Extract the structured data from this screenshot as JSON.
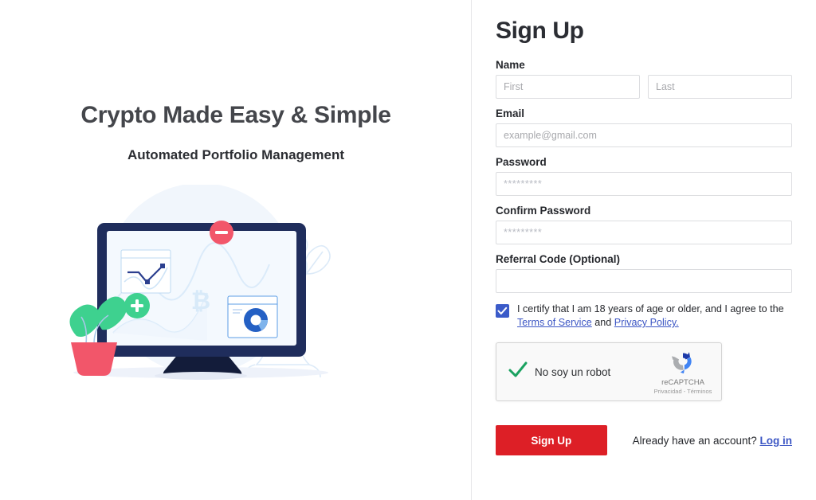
{
  "hero": {
    "title": "Crypto Made Easy & Simple",
    "subtitle": "Automated Portfolio Management",
    "illustration": {
      "bitcoin_glyph": "₿",
      "alt": "desktop monitor with trading charts, plant and vase"
    }
  },
  "form": {
    "heading": "Sign Up",
    "name": {
      "label": "Name",
      "first_placeholder": "First",
      "first_value": "",
      "last_placeholder": "Last",
      "last_value": ""
    },
    "email": {
      "label": "Email",
      "placeholder": "example@gmail.com",
      "value": ""
    },
    "password": {
      "label": "Password",
      "placeholder": "*********",
      "value": ""
    },
    "confirm_password": {
      "label": "Confirm Password",
      "placeholder": "*********",
      "value": ""
    },
    "referral": {
      "label": "Referral Code (Optional)",
      "placeholder": "",
      "value": ""
    },
    "certify": {
      "checked": true,
      "text_before": "I certify that I am 18 years of age or older, and I agree to the ",
      "terms_link": "Terms of Service",
      "text_between": " and ",
      "privacy_link": "Privacy Policy."
    },
    "recaptcha": {
      "label": "No soy un robot",
      "brand": "reCAPTCHA",
      "legal": "Privacidad - Términos",
      "verified": true
    },
    "submit_label": "Sign Up",
    "already_text": "Already have an account? ",
    "login_link": "Log in"
  },
  "colors": {
    "primary_red": "#dd1f26",
    "link_blue": "#3c56c4",
    "checkbox_blue": "#3b5bc9",
    "navy": "#1f2d5c",
    "accent_green": "#3ed18f",
    "accent_coral": "#f2566a",
    "chart_blue": "#2d6fd4",
    "pale_blue": "#f1f6fc"
  }
}
